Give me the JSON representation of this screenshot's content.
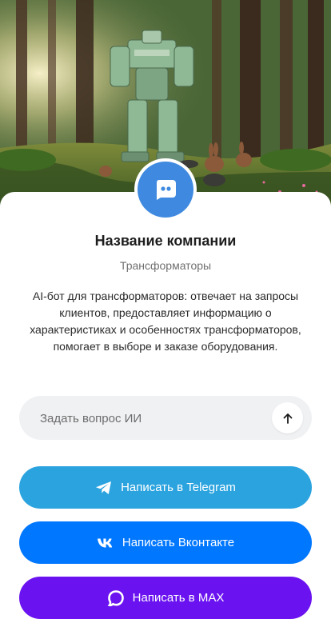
{
  "company": {
    "name": "Название компании",
    "category": "Трансформаторы",
    "description": "AI-бот для трансформаторов: отвечает на запросы клиентов, предоставляет информацию о характеристиках и особенностях трансформаторов, помогает в выборе и заказе оборудования.",
    "avatar_icon": "chat-bot-icon"
  },
  "ask": {
    "placeholder": "Задать вопрос ИИ",
    "send_icon": "arrow-up-icon"
  },
  "buttons": {
    "telegram_label": "Написать в Telegram",
    "vk_label": "Написать Вконтакте",
    "max_label": "Написать в MAX"
  },
  "colors": {
    "avatar": "#3f8ae0",
    "telegram": "#2aa3df",
    "vk": "#0077ff",
    "max": "#6a12f0"
  }
}
